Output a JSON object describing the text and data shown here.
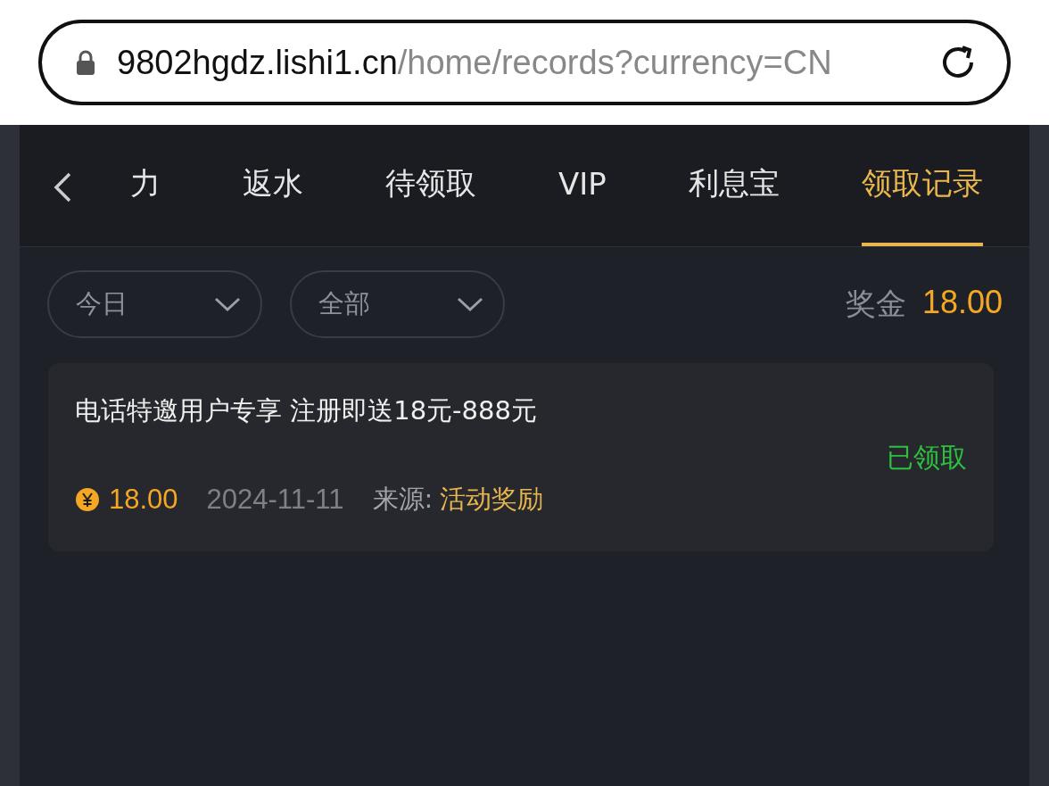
{
  "address_bar": {
    "domain": "9802hgdz.lishi1.cn",
    "path": "/home/records?currency=CN"
  },
  "tabs": [
    {
      "label": "力",
      "selected": false
    },
    {
      "label": "返水",
      "selected": false
    },
    {
      "label": "待领取",
      "selected": false
    },
    {
      "label": "VIP",
      "selected": false
    },
    {
      "label": "利息宝",
      "selected": false
    },
    {
      "label": "领取记录",
      "selected": true
    }
  ],
  "filters": [
    {
      "label": "今日"
    },
    {
      "label": "全部"
    }
  ],
  "bonus": {
    "label": "奖金",
    "amount": "18.00"
  },
  "records": [
    {
      "title": "电话特邀用户专享 注册即送18元-888元",
      "status": "已领取",
      "amount": "18.00",
      "date": "2024-11-11",
      "source_label": "来源:",
      "source": "活动奖励"
    }
  ]
}
